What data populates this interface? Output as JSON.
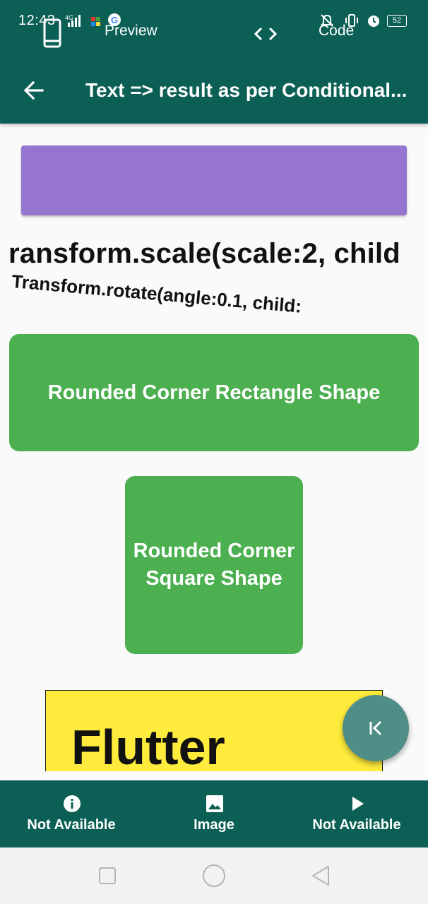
{
  "status_bar": {
    "time": "12:43",
    "network": "4G",
    "battery": "52"
  },
  "top_tabs": {
    "preview_label": "Preview",
    "code_label": "Code"
  },
  "app_bar": {
    "title": "Text => result as per Conditional..."
  },
  "content": {
    "scaled_text": "ransform.scale(scale:2, child",
    "rotated_text": "Transform.rotate(angle:0.1, child:",
    "rect_shape_label": "Rounded Corner Rectangle Shape",
    "square_shape_label_line1": "Rounded Corner",
    "square_shape_label_line2": "Square Shape",
    "flutter_text": "Flutter"
  },
  "bottom_nav": {
    "items": [
      {
        "label": "Not Available",
        "icon": "info-icon"
      },
      {
        "label": "Image",
        "icon": "image-icon"
      },
      {
        "label": "Not Available",
        "icon": "play-icon"
      }
    ]
  },
  "colors": {
    "primary": "#0b5f55",
    "purple": "#9575cd",
    "green": "#4caf50",
    "yellow": "#ffeb3b",
    "fab": "#4e8e86"
  }
}
